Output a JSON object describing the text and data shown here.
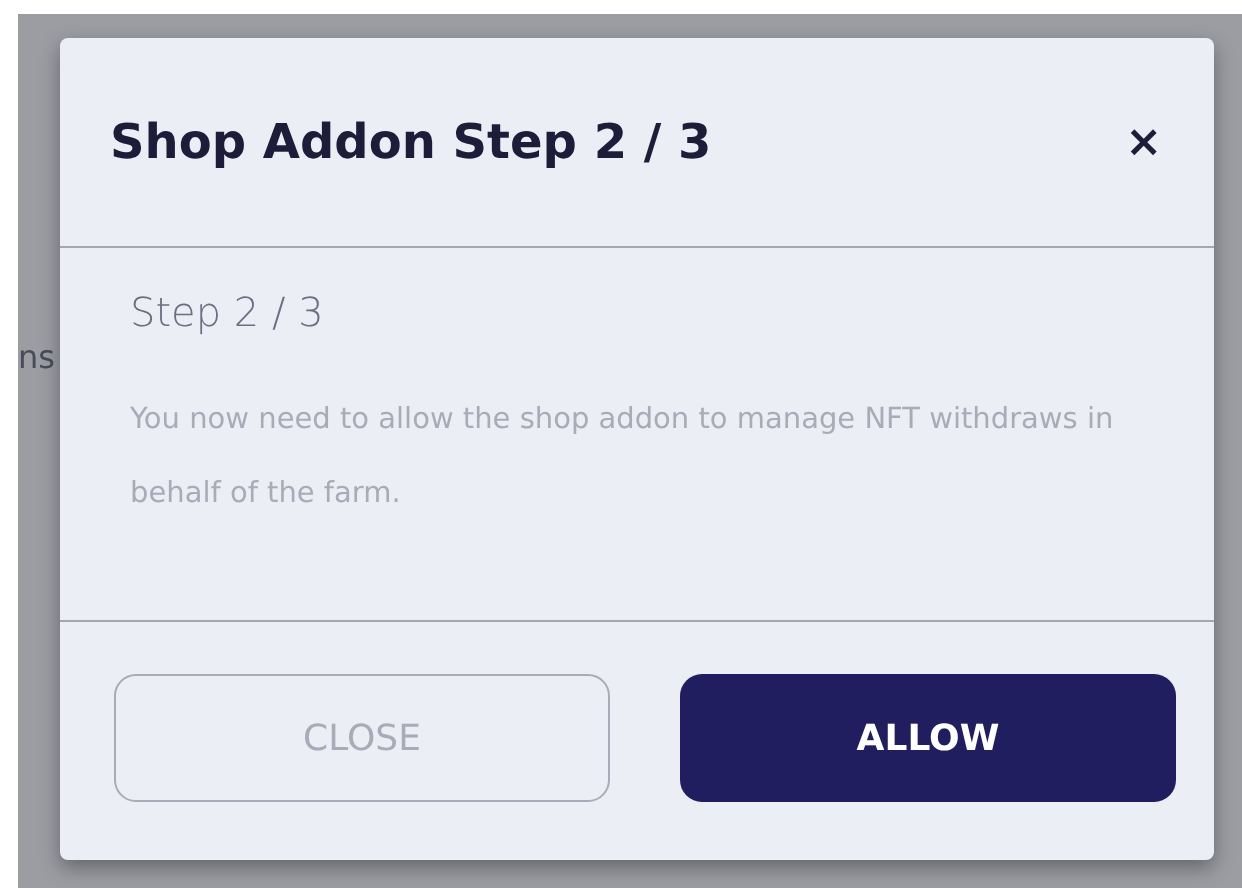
{
  "background_text": "ns",
  "dialog": {
    "title": "Shop Addon Step 2 / 3",
    "close_icon": "×",
    "subtitle": "Step 2 / 3",
    "message": "You now need to allow the shop addon to manage NFT withdraws in behalf of the farm.",
    "buttons": [
      {
        "label": "CLOSE",
        "kind": "secondary"
      },
      {
        "label": "ALLOW",
        "kind": "primary"
      }
    ]
  }
}
